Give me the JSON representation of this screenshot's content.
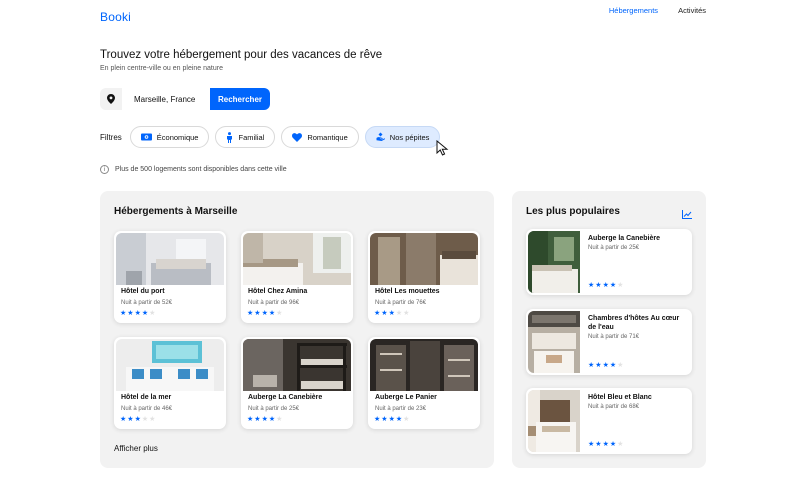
{
  "header": {
    "logo": "Booki",
    "nav": [
      "Hébergements",
      "Activités"
    ]
  },
  "hero": {
    "title": "Trouvez votre hébergement pour des vacances de rêve",
    "subtitle": "En plein centre-ville ou en pleine nature"
  },
  "search": {
    "value": "Marseille, France",
    "button_label": "Rechercher",
    "icon": "location-pin-icon"
  },
  "filters": {
    "label": "Filtres",
    "items": [
      {
        "label": "Économique",
        "icon": "money-icon"
      },
      {
        "label": "Familial",
        "icon": "person-icon"
      },
      {
        "label": "Romantique",
        "icon": "heart-icon"
      },
      {
        "label": "Nos pépites",
        "icon": "gem-hand-icon",
        "active": true
      }
    ]
  },
  "info": {
    "text": "Plus de 500 logements sont disponibles dans cette ville"
  },
  "accommodations": {
    "title": "Hébergements à Marseille",
    "items": [
      {
        "name": "Hôtel du port",
        "price": "Nuit à partir de 52€",
        "rating": 4
      },
      {
        "name": "Hôtel Chez Amina",
        "price": "Nuit à partir de 96€",
        "rating": 4
      },
      {
        "name": "Hôtel Les mouettes",
        "price": "Nuit à partir de 76€",
        "rating": 3
      },
      {
        "name": "Hôtel de la mer",
        "price": "Nuit à partir de 46€",
        "rating": 3
      },
      {
        "name": "Auberge La Canebière",
        "price": "Nuit à partir de 25€",
        "rating": 4
      },
      {
        "name": "Auberge Le Panier",
        "price": "Nuit à partir de 23€",
        "rating": 4
      }
    ],
    "show_more": "Afficher plus"
  },
  "popular": {
    "title": "Les plus populaires",
    "icon": "trend-chart-icon",
    "items": [
      {
        "name": "Auberge la Canebière",
        "price": "Nuit à partir de 25€",
        "rating": 4
      },
      {
        "name": "Chambres d'hôtes Au cœur de l'eau",
        "price": "Nuit à partir de 71€",
        "rating": 4
      },
      {
        "name": "Hôtel Bleu et Blanc",
        "price": "Nuit à partir de 68€",
        "rating": 4
      }
    ]
  },
  "colors": {
    "accent": "#0065FC",
    "panel": "#F2F2F2",
    "chip_active": "#DEEBFF"
  }
}
